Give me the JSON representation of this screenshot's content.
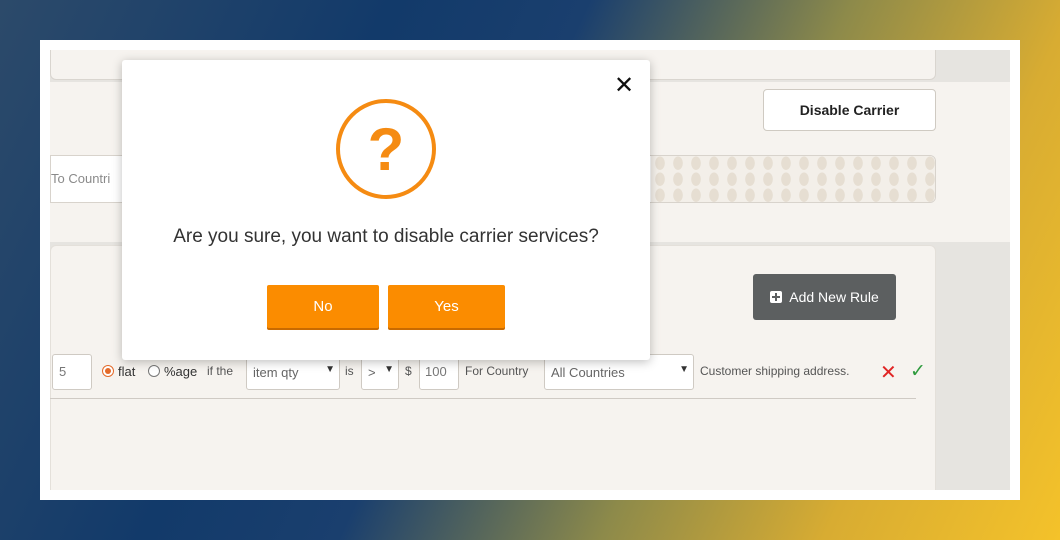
{
  "header": {
    "disable_label": "Disable Carrier"
  },
  "search": {
    "partial_text": "To Countri"
  },
  "rules": {
    "add_label": "Add New Rule",
    "row": {
      "qty_value": "5",
      "flat_label": "flat",
      "percent_label": "%age",
      "if_the": "if the",
      "condition_value": "item qty",
      "is_label": "is",
      "operator_value": ">",
      "currency_symbol": "$",
      "amount_value": "100",
      "for_country_label": "For Country",
      "country_value": "All Countries",
      "address_text": "Customer shipping address."
    }
  },
  "modal": {
    "question_mark": "?",
    "message": "Are you sure, you want to disable carrier services?",
    "no_label": "No",
    "yes_label": "Yes",
    "close_glyph": "✕"
  },
  "colors": {
    "accent": "#fb8c00",
    "icon_orange": "#f58b12",
    "delete_red": "#e02424",
    "confirm_green": "#2f9b3e"
  }
}
